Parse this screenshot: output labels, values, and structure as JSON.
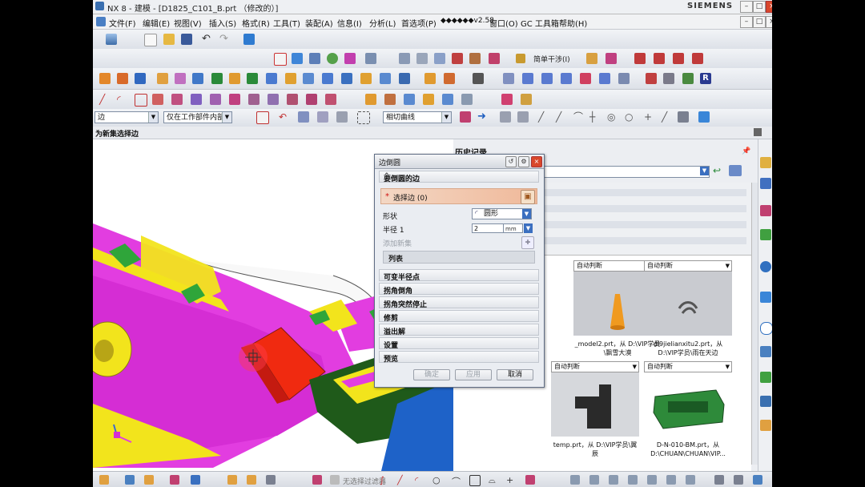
{
  "window": {
    "title": "NX 8 - 建模 - [D1825_C101_B.prt （修改的）]",
    "brand": "SIEMENS"
  },
  "menu": [
    "文件(F)",
    "编辑(E)",
    "视图(V)",
    "插入(S)",
    "格式(R)",
    "工具(T)",
    "装配(A)",
    "信息(I)",
    "分析(L)",
    "首选项(P)",
    "◆◆◆◆◆◆v2.58",
    "窗口(O)",
    "GC 工具箱",
    "帮助(H)"
  ],
  "toolbar": {
    "simple_step_label": "简单干涉(I)",
    "filter_type": "边",
    "filter_scope": "仅在工作部件内部",
    "curve_rule": "相切曲线"
  },
  "cue_line": "为新集选择边",
  "dialog": {
    "title": "边倒圆",
    "section_edges": "要倒圆的边",
    "select_edge_label": "选择边 (0)",
    "shape_label": "形状",
    "shape_value": "圆形",
    "radius_label": "半径 1",
    "radius_value": "2",
    "radius_unit": "mm",
    "add_set_label": "添加新集",
    "list_label": "列表",
    "sections": [
      "可变半径点",
      "拐角倒角",
      "拐角突然停止",
      "修剪",
      "溢出解",
      "设置",
      "预览"
    ],
    "ok_label": "确定",
    "apply_label": "应用",
    "cancel_label": "取消"
  },
  "resource": {
    "header": "历史记录",
    "thumbnails": [
      {
        "header": "自动判断",
        "caption": "_model2.prt，从 D:\\VIP学员\\飘雪大漠"
      },
      {
        "header": "自动判断",
        "caption": "di9jielianxitu2.prt，从 D:\\VIP学员\\雨在天边"
      },
      {
        "header": "自动判断",
        "caption": "temp.prt，从 D:\\VIP学员\\翼辰"
      },
      {
        "header": "自动判断",
        "caption": "D-N-010-BM.prt，从 D:\\CHUAN\\CHUAN\\VIP..."
      }
    ]
  },
  "status": {
    "text": "无选择过滤器"
  },
  "colors": {
    "magenta_body": "#e23de0",
    "accent_red": "#f02a10",
    "yellow_rib": "#f2e41c",
    "green_strip": "#2fa53a",
    "dark_green": "#1f5a1a",
    "blue_face": "#1e62c8",
    "dialog_select_highlight": "#f0b99a"
  }
}
